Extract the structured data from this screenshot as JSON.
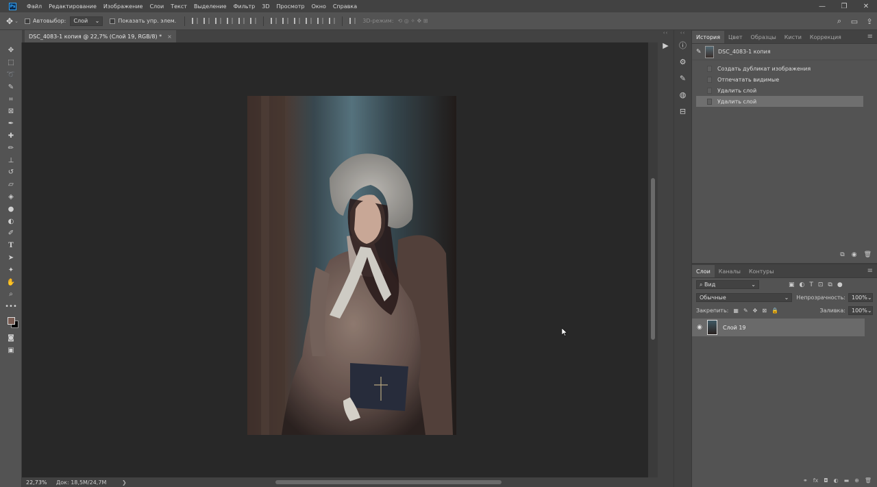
{
  "app": {
    "logo": "Ps"
  },
  "menu": [
    "Файл",
    "Редактирование",
    "Изображение",
    "Слои",
    "Текст",
    "Выделение",
    "Фильтр",
    "3D",
    "Просмотр",
    "Окно",
    "Справка"
  ],
  "window_controls": [
    "—",
    "❐",
    "✕"
  ],
  "options": {
    "autoselect_label": "Автовыбор:",
    "autoselect_value": "Слой",
    "show_transform_label": "Показать упр. элем.",
    "mode3d_label": "3D-режим:"
  },
  "document": {
    "tab_title": "DSC_4083-1 копия @ 22,7% (Слой 19, RGB/8) *",
    "close_glyph": "×"
  },
  "status": {
    "zoom": "22,73%",
    "doc_info": "Док: 18,5M/24,7M"
  },
  "history": {
    "tabs": [
      "История",
      "Цвет",
      "Образцы",
      "Кисти",
      "Коррекция"
    ],
    "snapshot_label": "DSC_4083-1 копия",
    "items": [
      {
        "label": "Создать дубликат изображения"
      },
      {
        "label": "Отпечатать видимые"
      },
      {
        "label": "Удалить слой"
      },
      {
        "label": "Удалить слой"
      }
    ],
    "selected_index": 3
  },
  "layers": {
    "tabs": [
      "Слои",
      "Каналы",
      "Контуры"
    ],
    "filter_value": "Вид",
    "blend_mode": "Обычные",
    "opacity_label": "Непрозрачность:",
    "opacity_value": "100%",
    "lock_label": "Закрепить:",
    "fill_label": "Заливка:",
    "fill_value": "100%",
    "items": [
      {
        "name": "Слой 19",
        "visible": true
      }
    ]
  },
  "colors": {
    "foreground": "#7a5c52",
    "background": "#000000",
    "accent": "#31a8ff"
  },
  "icons": {
    "toolbar": [
      "move-icon",
      "marquee-icon",
      "lasso-icon",
      "quick-select-icon",
      "crop-icon",
      "frame-icon",
      "eyedropper-icon",
      "healing-brush-icon",
      "brush-icon",
      "clone-stamp-icon",
      "history-brush-icon",
      "eraser-icon",
      "paint-bucket-icon",
      "blur-icon",
      "dodge-icon",
      "pen-icon",
      "type-icon",
      "path-select-icon",
      "shape-icon",
      "hand-icon",
      "zoom-icon",
      "more-tools-icon"
    ]
  }
}
